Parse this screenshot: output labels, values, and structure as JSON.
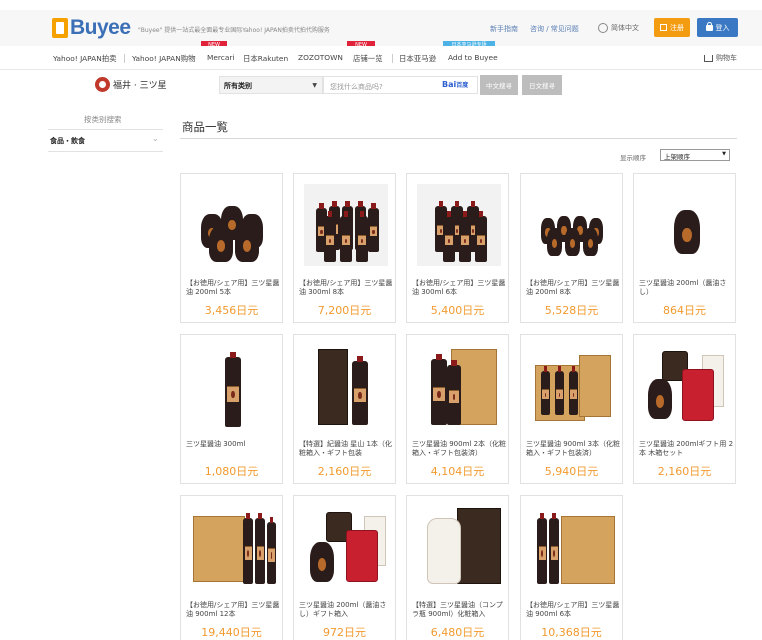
{
  "header": {
    "logo": "Buyee",
    "tagline": "\"Buyee\" 提供一站式最全面最专业国际Yahoo! JAPAN拍卖代拍代购服务",
    "links": [
      "新手指南",
      "咨询 / 常见问题"
    ],
    "language": "简体中文",
    "register": "注册",
    "login": "登入"
  },
  "nav": {
    "items": [
      "Yahoo! JAPAN拍卖",
      "Yahoo! JAPAN购物",
      "Mercari",
      "日本Rakuten",
      "ZOZOTOWN",
      "店铺一览",
      "日本亚马逊",
      "Add to Buyee"
    ],
    "badges": [
      "NEW",
      "NEW",
      "日本亚马逊专场"
    ],
    "cart": "购物车"
  },
  "search": {
    "shop_name": "福井 · 三ツ星",
    "category": "所有类别",
    "placeholder": "您找什么商品吗?",
    "engine": "Bai",
    "engine2": "百度",
    "btn_cn": "中文搜寻",
    "btn_jp": "日文搜寻"
  },
  "sidebar": {
    "title": "按类别搜索",
    "item": "食品・飲食"
  },
  "main": {
    "title": "商品一覧",
    "sort_label": "显示顺序",
    "sort_value": "上架顺序"
  },
  "products": [
    {
      "name": "【お徳用/シェア用】三ツ星醤油 200ml 5本",
      "price": "3,456日元"
    },
    {
      "name": "【お徳用/シェア用】三ツ星醤油 300ml 8本",
      "price": "7,200日元"
    },
    {
      "name": "【お徳用/シェア用】三ツ星醤油 300ml 6本",
      "price": "5,400日元"
    },
    {
      "name": "【お徳用/シェア用】三ツ星醤油 200ml 8本",
      "price": "5,528日元"
    },
    {
      "name": "三ツ星醤油 200ml（醤油さし）",
      "price": "864日元"
    },
    {
      "name": "三ツ星醤油 300ml",
      "price": "1,080日元"
    },
    {
      "name": "【特選】紀醤油 星山 1本（化粧箱入・ギフト包装",
      "price": "2,160日元"
    },
    {
      "name": "三ツ星醤油 900ml 2本（化粧箱入・ギフト包装済）",
      "price": "4,104日元"
    },
    {
      "name": "三ツ星醤油 900ml 3本（化粧箱入・ギフト包装済）",
      "price": "5,940日元"
    },
    {
      "name": "三ツ星醤油 200mlギフト用 2本 木箱セット",
      "price": "2,160日元"
    },
    {
      "name": "【お徳用/シェア用】三ツ星醤油 900ml 12本",
      "price": "19,440日元"
    },
    {
      "name": "三ツ星醤油 200ml（醤油さし）ギフト箱入",
      "price": "972日元"
    },
    {
      "name": "【特選】三ツ星醤油（コンプラ瓶 900ml）化粧箱入",
      "price": "6,480日元"
    },
    {
      "name": "【お徳用/シェア用】三ツ星醤油 900ml 6本",
      "price": "10,368日元"
    }
  ]
}
